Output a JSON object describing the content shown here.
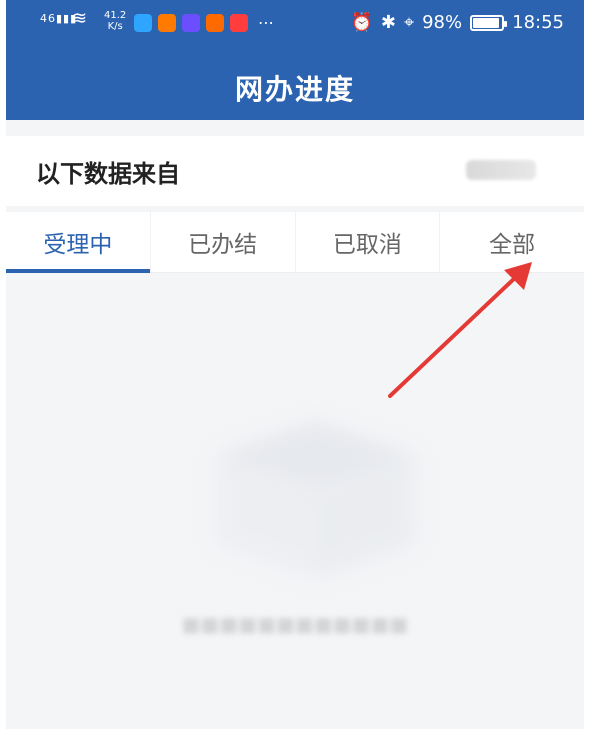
{
  "status_bar": {
    "signal": "46",
    "network_speed_value": "41.2",
    "network_speed_unit": "K/s",
    "battery_percent_text": "98%",
    "battery_level": 0.98,
    "time": "18:55",
    "app_icon_colors": [
      "#2ea6ff",
      "#ff7a00",
      "#6b4eff",
      "#ff6a00",
      "#ff3d3d"
    ],
    "icons": [
      "signal-icon",
      "wifi-icon",
      "app-icons",
      "more-icon",
      "alarm-icon",
      "bluetooth-icon",
      "location-icon",
      "battery-icon"
    ]
  },
  "header": {
    "title": "网办进度",
    "bg_color": "#2b63b0"
  },
  "source_row": {
    "label": "以下数据来自"
  },
  "tabs": [
    {
      "label": "受理中",
      "active": true
    },
    {
      "label": "已办结",
      "active": false
    },
    {
      "label": "已取消",
      "active": false
    },
    {
      "label": "全部",
      "active": false
    }
  ],
  "annotation": {
    "arrow_color": "#e53935"
  }
}
